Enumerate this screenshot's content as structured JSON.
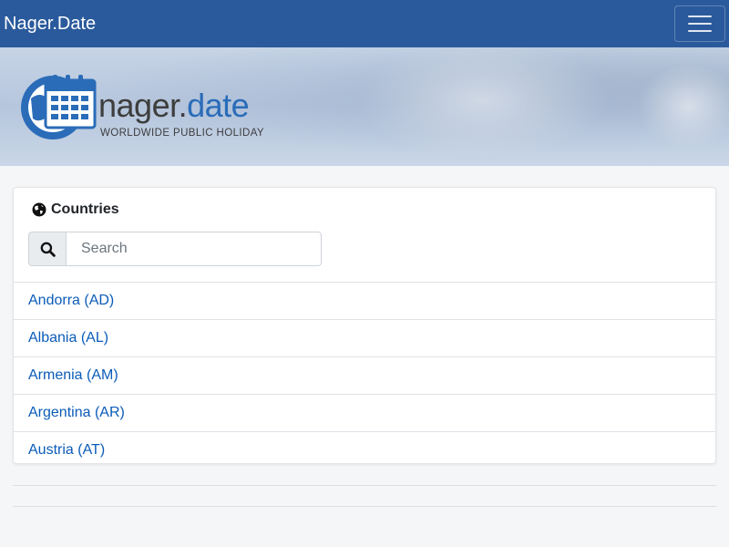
{
  "navbar": {
    "brand": "Nager.Date",
    "menu_icon": "hamburger-menu-icon"
  },
  "banner": {
    "logo": {
      "word_part1": "nager.",
      "word_part2": "date",
      "tagline": "WORLDWIDE PUBLIC HOLIDAY",
      "icon": "globe-calendar-icon"
    }
  },
  "countries_card": {
    "title": "Countries",
    "title_icon": "globe-icon",
    "search": {
      "icon": "search-icon",
      "placeholder": "Search",
      "value": ""
    },
    "items": [
      {
        "label": "Andorra (AD)"
      },
      {
        "label": "Albania (AL)"
      },
      {
        "label": "Armenia (AM)"
      },
      {
        "label": "Argentina (AR)"
      },
      {
        "label": "Austria (AT)"
      }
    ]
  },
  "colors": {
    "navbar": "#2a5a9c",
    "link": "#0b5cb8",
    "logo_blue": "#2a6cb8",
    "background": "#f5f6f8"
  }
}
